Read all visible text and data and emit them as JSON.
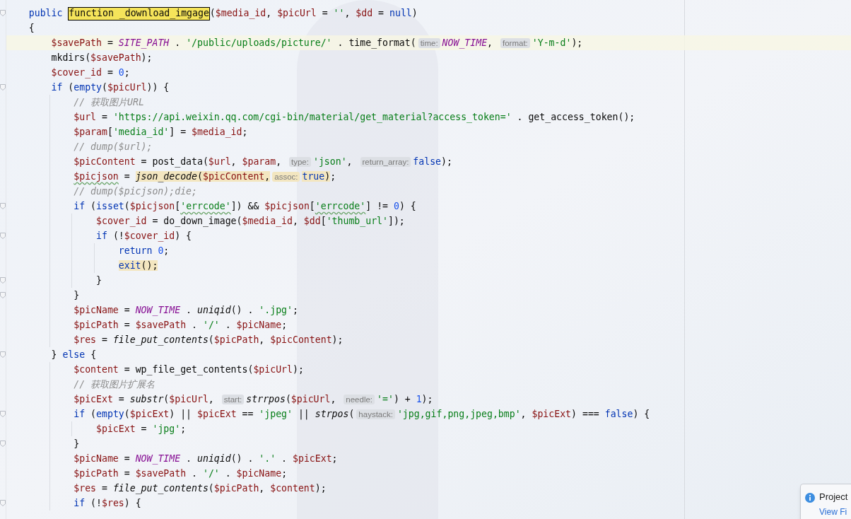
{
  "editor": {
    "lines": [
      {
        "fold": true,
        "current": false,
        "tokens": [
          {
            "kind": "kw",
            "text": "    public "
          },
          {
            "kind": "p",
            "text": "function _download_imgage",
            "match": true
          },
          {
            "kind": "p",
            "text": "("
          },
          {
            "kind": "v",
            "text": "$media_id"
          },
          {
            "kind": "p",
            "text": ", "
          },
          {
            "kind": "v",
            "text": "$picUrl"
          },
          {
            "kind": "p",
            "text": " = "
          },
          {
            "kind": "s",
            "text": "''"
          },
          {
            "kind": "p",
            "text": ", "
          },
          {
            "kind": "v",
            "text": "$dd"
          },
          {
            "kind": "p",
            "text": " = "
          },
          {
            "kind": "kw",
            "text": "null"
          },
          {
            "kind": "p",
            "text": ")"
          }
        ]
      },
      {
        "fold": false,
        "current": false,
        "tokens": [
          {
            "kind": "p",
            "text": "    {"
          }
        ]
      },
      {
        "fold": false,
        "current": true,
        "tokens": [
          {
            "kind": "v",
            "text": "        $savePath"
          },
          {
            "kind": "p",
            "text": " = "
          },
          {
            "kind": "c",
            "text": "SITE_PATH"
          },
          {
            "kind": "p",
            "text": " . "
          },
          {
            "kind": "s",
            "text": "'/public/uploads/picture/'"
          },
          {
            "kind": "p",
            "text": " . time_format("
          },
          {
            "kind": "h",
            "text": "time:"
          },
          {
            "kind": "c",
            "text": "NOW_TIME"
          },
          {
            "kind": "p",
            "text": ", "
          },
          {
            "kind": "h",
            "text": "format:"
          },
          {
            "kind": "s",
            "text": "'Y-m-d'"
          },
          {
            "kind": "p",
            "text": ");"
          }
        ]
      },
      {
        "fold": false,
        "current": false,
        "tokens": [
          {
            "kind": "p",
            "text": "        mkdirs("
          },
          {
            "kind": "v",
            "text": "$savePath"
          },
          {
            "kind": "p",
            "text": ");"
          }
        ]
      },
      {
        "fold": false,
        "current": false,
        "tokens": [
          {
            "kind": "v",
            "text": "        $cover_id"
          },
          {
            "kind": "p",
            "text": " = "
          },
          {
            "kind": "n",
            "text": "0"
          },
          {
            "kind": "p",
            "text": ";"
          }
        ]
      },
      {
        "fold": true,
        "current": false,
        "tokens": [
          {
            "kind": "kw",
            "text": "        if"
          },
          {
            "kind": "p",
            "text": " ("
          },
          {
            "kind": "kw",
            "text": "empty"
          },
          {
            "kind": "p",
            "text": "("
          },
          {
            "kind": "v",
            "text": "$picUrl"
          },
          {
            "kind": "p",
            "text": ")) {"
          }
        ]
      },
      {
        "fold": false,
        "current": false,
        "tokens": [
          {
            "kind": "cm",
            "text": "            // 获取图片URL"
          }
        ]
      },
      {
        "fold": false,
        "current": false,
        "tokens": [
          {
            "kind": "v",
            "text": "            $url"
          },
          {
            "kind": "p",
            "text": " = "
          },
          {
            "kind": "s",
            "text": "'https://api.weixin.qq.com/cgi-bin/material/get_material?access_token='"
          },
          {
            "kind": "p",
            "text": " . get_access_token();"
          }
        ]
      },
      {
        "fold": false,
        "current": false,
        "tokens": [
          {
            "kind": "v",
            "text": "            $param"
          },
          {
            "kind": "p",
            "text": "["
          },
          {
            "kind": "s",
            "text": "'media_id'"
          },
          {
            "kind": "p",
            "text": "] = "
          },
          {
            "kind": "v",
            "text": "$media_id"
          },
          {
            "kind": "p",
            "text": ";"
          }
        ]
      },
      {
        "fold": false,
        "current": false,
        "tokens": [
          {
            "kind": "cm",
            "text": "            // dump($url);"
          }
        ]
      },
      {
        "fold": false,
        "current": false,
        "tokens": [
          {
            "kind": "v",
            "text": "            $picContent"
          },
          {
            "kind": "p",
            "text": " = post_data("
          },
          {
            "kind": "v",
            "text": "$url"
          },
          {
            "kind": "p",
            "text": ", "
          },
          {
            "kind": "v",
            "text": "$param"
          },
          {
            "kind": "p",
            "text": ", "
          },
          {
            "kind": "h",
            "text": "type:"
          },
          {
            "kind": "s",
            "text": "'json'"
          },
          {
            "kind": "p",
            "text": ", "
          },
          {
            "kind": "h",
            "text": "return_array:"
          },
          {
            "kind": "kw",
            "text": "false"
          },
          {
            "kind": "p",
            "text": ");"
          }
        ]
      },
      {
        "fold": false,
        "current": false,
        "tokens": [
          {
            "kind": "v",
            "text": "            $picjson",
            "warning": true
          },
          {
            "kind": "p",
            "text": " = "
          },
          {
            "kind": "f",
            "text": "json_decode",
            "usage": true
          },
          {
            "kind": "p",
            "text": "(",
            "usage": true
          },
          {
            "kind": "v",
            "text": "$picContent",
            "usage": true
          },
          {
            "kind": "p",
            "text": ",",
            "usage": true
          },
          {
            "kind": "h",
            "text": "assoc:",
            "usage": true
          },
          {
            "kind": "kw",
            "text": "true",
            "usage": true
          },
          {
            "kind": "p",
            "text": ")",
            "usage": true
          },
          {
            "kind": "p",
            "text": ";"
          }
        ]
      },
      {
        "fold": false,
        "current": false,
        "tokens": [
          {
            "kind": "cm",
            "text": "            // dump($picjson);die;"
          }
        ]
      },
      {
        "fold": true,
        "current": false,
        "tokens": [
          {
            "kind": "kw",
            "text": "            if"
          },
          {
            "kind": "p",
            "text": " ("
          },
          {
            "kind": "kw",
            "text": "isset"
          },
          {
            "kind": "p",
            "text": "("
          },
          {
            "kind": "v",
            "text": "$picjson"
          },
          {
            "kind": "p",
            "text": "["
          },
          {
            "kind": "s",
            "text": "'errcode'",
            "warning": true
          },
          {
            "kind": "p",
            "text": "]) && "
          },
          {
            "kind": "v",
            "text": "$picjson"
          },
          {
            "kind": "p",
            "text": "["
          },
          {
            "kind": "s",
            "text": "'errcode'",
            "warning": true
          },
          {
            "kind": "p",
            "text": "] != "
          },
          {
            "kind": "n",
            "text": "0"
          },
          {
            "kind": "p",
            "text": ") {"
          }
        ]
      },
      {
        "fold": false,
        "current": false,
        "tokens": [
          {
            "kind": "v",
            "text": "                $cover_id"
          },
          {
            "kind": "p",
            "text": " = do_down_image("
          },
          {
            "kind": "v",
            "text": "$media_id"
          },
          {
            "kind": "p",
            "text": ", "
          },
          {
            "kind": "v",
            "text": "$dd"
          },
          {
            "kind": "p",
            "text": "["
          },
          {
            "kind": "s",
            "text": "'thumb_url'"
          },
          {
            "kind": "p",
            "text": "]);"
          }
        ]
      },
      {
        "fold": true,
        "current": false,
        "tokens": [
          {
            "kind": "kw",
            "text": "                if"
          },
          {
            "kind": "p",
            "text": " (!"
          },
          {
            "kind": "v",
            "text": "$cover_id"
          },
          {
            "kind": "p",
            "text": ") {"
          }
        ]
      },
      {
        "fold": false,
        "current": false,
        "tokens": [
          {
            "kind": "kw",
            "text": "                    return "
          },
          {
            "kind": "n",
            "text": "0"
          },
          {
            "kind": "p",
            "text": ";"
          }
        ]
      },
      {
        "fold": false,
        "current": false,
        "tokens": [
          {
            "kind": "kw",
            "text": "                    exit",
            "usage": true
          },
          {
            "kind": "p",
            "text": "();",
            "usage": true
          }
        ]
      },
      {
        "fold": true,
        "current": false,
        "tokens": [
          {
            "kind": "p",
            "text": "                }"
          }
        ]
      },
      {
        "fold": true,
        "current": false,
        "tokens": [
          {
            "kind": "p",
            "text": "            }"
          }
        ]
      },
      {
        "fold": false,
        "current": false,
        "tokens": [
          {
            "kind": "v",
            "text": "            $picName"
          },
          {
            "kind": "p",
            "text": " = "
          },
          {
            "kind": "c",
            "text": "NOW_TIME"
          },
          {
            "kind": "p",
            "text": " . "
          },
          {
            "kind": "f",
            "text": "uniqid"
          },
          {
            "kind": "p",
            "text": "() . "
          },
          {
            "kind": "s",
            "text": "'.jpg'"
          },
          {
            "kind": "p",
            "text": ";"
          }
        ]
      },
      {
        "fold": false,
        "current": false,
        "tokens": [
          {
            "kind": "v",
            "text": "            $picPath"
          },
          {
            "kind": "p",
            "text": " = "
          },
          {
            "kind": "v",
            "text": "$savePath"
          },
          {
            "kind": "p",
            "text": " . "
          },
          {
            "kind": "s",
            "text": "'/'"
          },
          {
            "kind": "p",
            "text": " . "
          },
          {
            "kind": "v",
            "text": "$picName"
          },
          {
            "kind": "p",
            "text": ";"
          }
        ]
      },
      {
        "fold": false,
        "current": false,
        "tokens": [
          {
            "kind": "v",
            "text": "            $res"
          },
          {
            "kind": "p",
            "text": " = "
          },
          {
            "kind": "f",
            "text": "file_put_contents"
          },
          {
            "kind": "p",
            "text": "("
          },
          {
            "kind": "v",
            "text": "$picPath"
          },
          {
            "kind": "p",
            "text": ", "
          },
          {
            "kind": "v",
            "text": "$picContent"
          },
          {
            "kind": "p",
            "text": ");"
          }
        ]
      },
      {
        "fold": true,
        "current": false,
        "tokens": [
          {
            "kind": "p",
            "text": "        } "
          },
          {
            "kind": "kw",
            "text": "else"
          },
          {
            "kind": "p",
            "text": " {"
          }
        ]
      },
      {
        "fold": false,
        "current": false,
        "tokens": [
          {
            "kind": "v",
            "text": "            $content"
          },
          {
            "kind": "p",
            "text": " = wp_file_get_contents("
          },
          {
            "kind": "v",
            "text": "$picUrl"
          },
          {
            "kind": "p",
            "text": ");"
          }
        ]
      },
      {
        "fold": false,
        "current": false,
        "tokens": [
          {
            "kind": "cm",
            "text": "            // 获取图片扩展名"
          }
        ]
      },
      {
        "fold": false,
        "current": false,
        "tokens": [
          {
            "kind": "v",
            "text": "            $picExt"
          },
          {
            "kind": "p",
            "text": " = "
          },
          {
            "kind": "f",
            "text": "substr"
          },
          {
            "kind": "p",
            "text": "("
          },
          {
            "kind": "v",
            "text": "$picUrl"
          },
          {
            "kind": "p",
            "text": ", "
          },
          {
            "kind": "h",
            "text": "start:"
          },
          {
            "kind": "f",
            "text": "strrpos"
          },
          {
            "kind": "p",
            "text": "("
          },
          {
            "kind": "v",
            "text": "$picUrl"
          },
          {
            "kind": "p",
            "text": ", "
          },
          {
            "kind": "h",
            "text": "needle:"
          },
          {
            "kind": "s",
            "text": "'='"
          },
          {
            "kind": "p",
            "text": ") + "
          },
          {
            "kind": "n",
            "text": "1"
          },
          {
            "kind": "p",
            "text": ");"
          }
        ]
      },
      {
        "fold": true,
        "current": false,
        "tokens": [
          {
            "kind": "kw",
            "text": "            if"
          },
          {
            "kind": "p",
            "text": " ("
          },
          {
            "kind": "kw",
            "text": "empty"
          },
          {
            "kind": "p",
            "text": "("
          },
          {
            "kind": "v",
            "text": "$picExt"
          },
          {
            "kind": "p",
            "text": ") || "
          },
          {
            "kind": "v",
            "text": "$picExt"
          },
          {
            "kind": "p",
            "text": " == "
          },
          {
            "kind": "s",
            "text": "'jpeg'"
          },
          {
            "kind": "p",
            "text": " || "
          },
          {
            "kind": "f",
            "text": "strpos"
          },
          {
            "kind": "p",
            "text": "("
          },
          {
            "kind": "h",
            "text": "haystack:"
          },
          {
            "kind": "s",
            "text": "'jpg,gif,png,jpeg,bmp'"
          },
          {
            "kind": "p",
            "text": ", "
          },
          {
            "kind": "v",
            "text": "$picExt"
          },
          {
            "kind": "p",
            "text": ") === "
          },
          {
            "kind": "kw",
            "text": "false"
          },
          {
            "kind": "p",
            "text": ") {"
          }
        ]
      },
      {
        "fold": false,
        "current": false,
        "tokens": [
          {
            "kind": "v",
            "text": "                $picExt"
          },
          {
            "kind": "p",
            "text": " = "
          },
          {
            "kind": "s",
            "text": "'jpg'"
          },
          {
            "kind": "p",
            "text": ";"
          }
        ]
      },
      {
        "fold": true,
        "current": false,
        "tokens": [
          {
            "kind": "p",
            "text": "            }"
          }
        ]
      },
      {
        "fold": false,
        "current": false,
        "tokens": [
          {
            "kind": "v",
            "text": "            $picName"
          },
          {
            "kind": "p",
            "text": " = "
          },
          {
            "kind": "c",
            "text": "NOW_TIME"
          },
          {
            "kind": "p",
            "text": " . "
          },
          {
            "kind": "f",
            "text": "uniqid"
          },
          {
            "kind": "p",
            "text": "() . "
          },
          {
            "kind": "s",
            "text": "'.'"
          },
          {
            "kind": "p",
            "text": " . "
          },
          {
            "kind": "v",
            "text": "$picExt"
          },
          {
            "kind": "p",
            "text": ";"
          }
        ]
      },
      {
        "fold": false,
        "current": false,
        "tokens": [
          {
            "kind": "v",
            "text": "            $picPath"
          },
          {
            "kind": "p",
            "text": " = "
          },
          {
            "kind": "v",
            "text": "$savePath"
          },
          {
            "kind": "p",
            "text": " . "
          },
          {
            "kind": "s",
            "text": "'/'"
          },
          {
            "kind": "p",
            "text": " . "
          },
          {
            "kind": "v",
            "text": "$picName"
          },
          {
            "kind": "p",
            "text": ";"
          }
        ]
      },
      {
        "fold": false,
        "current": false,
        "tokens": [
          {
            "kind": "v",
            "text": "            $res"
          },
          {
            "kind": "p",
            "text": " = "
          },
          {
            "kind": "f",
            "text": "file_put_contents"
          },
          {
            "kind": "p",
            "text": "("
          },
          {
            "kind": "v",
            "text": "$picPath"
          },
          {
            "kind": "p",
            "text": ", "
          },
          {
            "kind": "v",
            "text": "$content"
          },
          {
            "kind": "p",
            "text": ");"
          }
        ]
      },
      {
        "fold": true,
        "current": false,
        "tokens": [
          {
            "kind": "kw",
            "text": "            if"
          },
          {
            "kind": "p",
            "text": " (!"
          },
          {
            "kind": "v",
            "text": "$res"
          },
          {
            "kind": "p",
            "text": ") {"
          }
        ]
      }
    ]
  },
  "notification": {
    "title": "Project",
    "link": "View Fi"
  }
}
